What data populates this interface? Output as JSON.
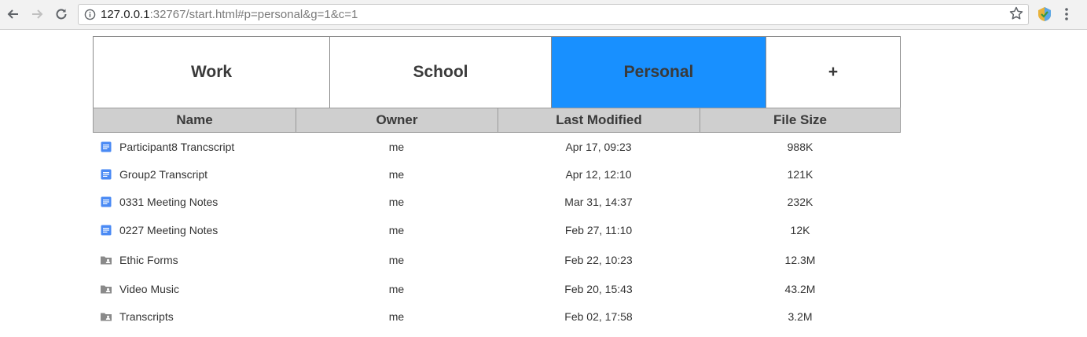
{
  "browser": {
    "url_host": "127.0.0.1",
    "url_rest": ":32767/start.html#p=personal&g=1&c=1"
  },
  "tabs": [
    {
      "label": "Work",
      "active": false
    },
    {
      "label": "School",
      "active": false
    },
    {
      "label": "Personal",
      "active": true
    },
    {
      "label": "+",
      "active": false
    }
  ],
  "colors": {
    "active_tab": "#1890ff",
    "header_bg": "#cfcfcf",
    "doc_icon": "#4a8af4",
    "folder_icon": "#8a8a8a"
  },
  "table": {
    "columns": [
      "Name",
      "Owner",
      "Last Modified",
      "File Size"
    ],
    "rows": [
      {
        "icon": "doc-icon",
        "name": "Participant8 Trancscript",
        "owner": "me",
        "modified": "Apr 17, 09:23",
        "size": "988K"
      },
      {
        "icon": "doc-icon",
        "name": "Group2 Transcript",
        "owner": "me",
        "modified": "Apr 12, 12:10",
        "size": "121K"
      },
      {
        "icon": "doc-icon",
        "name": "0331 Meeting Notes",
        "owner": "me",
        "modified": "Mar 31, 14:37",
        "size": "232K"
      },
      {
        "icon": "doc-icon",
        "name": "0227 Meeting Notes",
        "owner": "me",
        "modified": "Feb 27, 11:10",
        "size": "12K"
      },
      {
        "icon": "shared-folder-icon",
        "name": "Ethic Forms",
        "owner": "me",
        "modified": "Feb 22, 10:23",
        "size": "12.3M"
      },
      {
        "icon": "shared-folder-icon",
        "name": "Video Music",
        "owner": "me",
        "modified": "Feb 20, 15:43",
        "size": "43.2M"
      },
      {
        "icon": "shared-folder-icon",
        "name": "Transcripts",
        "owner": "me",
        "modified": "Feb 02, 17:58",
        "size": "3.2M"
      }
    ]
  }
}
